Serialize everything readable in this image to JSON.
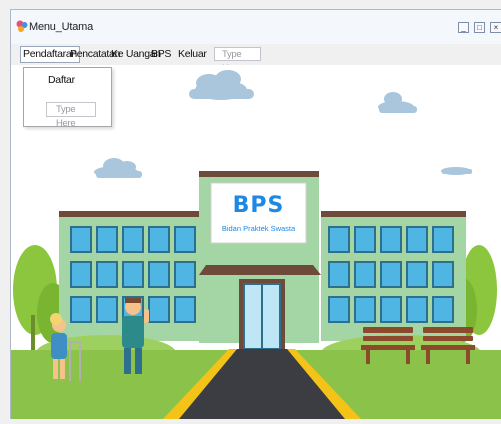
{
  "window": {
    "title": "Menu_Utama",
    "controls": [
      "minimize",
      "maximize",
      "close"
    ]
  },
  "menu": {
    "items": [
      {
        "label": "Pendaftaran",
        "open": true
      },
      {
        "label": "Pencatatan"
      },
      {
        "label": "Ke Uangan"
      },
      {
        "label": "BPS"
      },
      {
        "label": "Keluar"
      }
    ],
    "textbox_placeholder": "Type Here"
  },
  "dropdown": {
    "items": [
      {
        "label": "Daftar"
      }
    ],
    "textbox_placeholder": "Type Here"
  },
  "scene": {
    "sign_title": "BPS",
    "sign_subtitle": "Bidan Praktek Swasta",
    "colors": {
      "sky": "#ffffff",
      "building": "#a3d6a4",
      "roof": "#6e4a3a",
      "window": "#4fb6e3",
      "grass": "#8bc34a",
      "road": "#3b3d42",
      "road_edge": "#f3c318",
      "sign_text": "#1e88e5"
    }
  }
}
